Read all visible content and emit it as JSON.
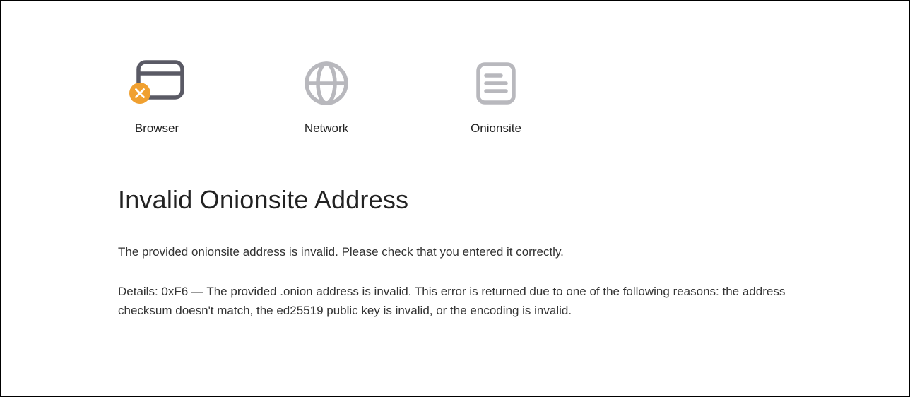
{
  "icons": {
    "browser": {
      "label": "Browser"
    },
    "network": {
      "label": "Network"
    },
    "onionsite": {
      "label": "Onionsite"
    }
  },
  "title": "Invalid Onionsite Address",
  "message": "The provided onionsite address is invalid. Please check that you entered it correctly.",
  "details": "Details: 0xF6 — The provided .onion address is invalid. This error is returned due to one of the following reasons: the address checksum doesn't match, the ed25519 public key is invalid, or the encoding is invalid."
}
